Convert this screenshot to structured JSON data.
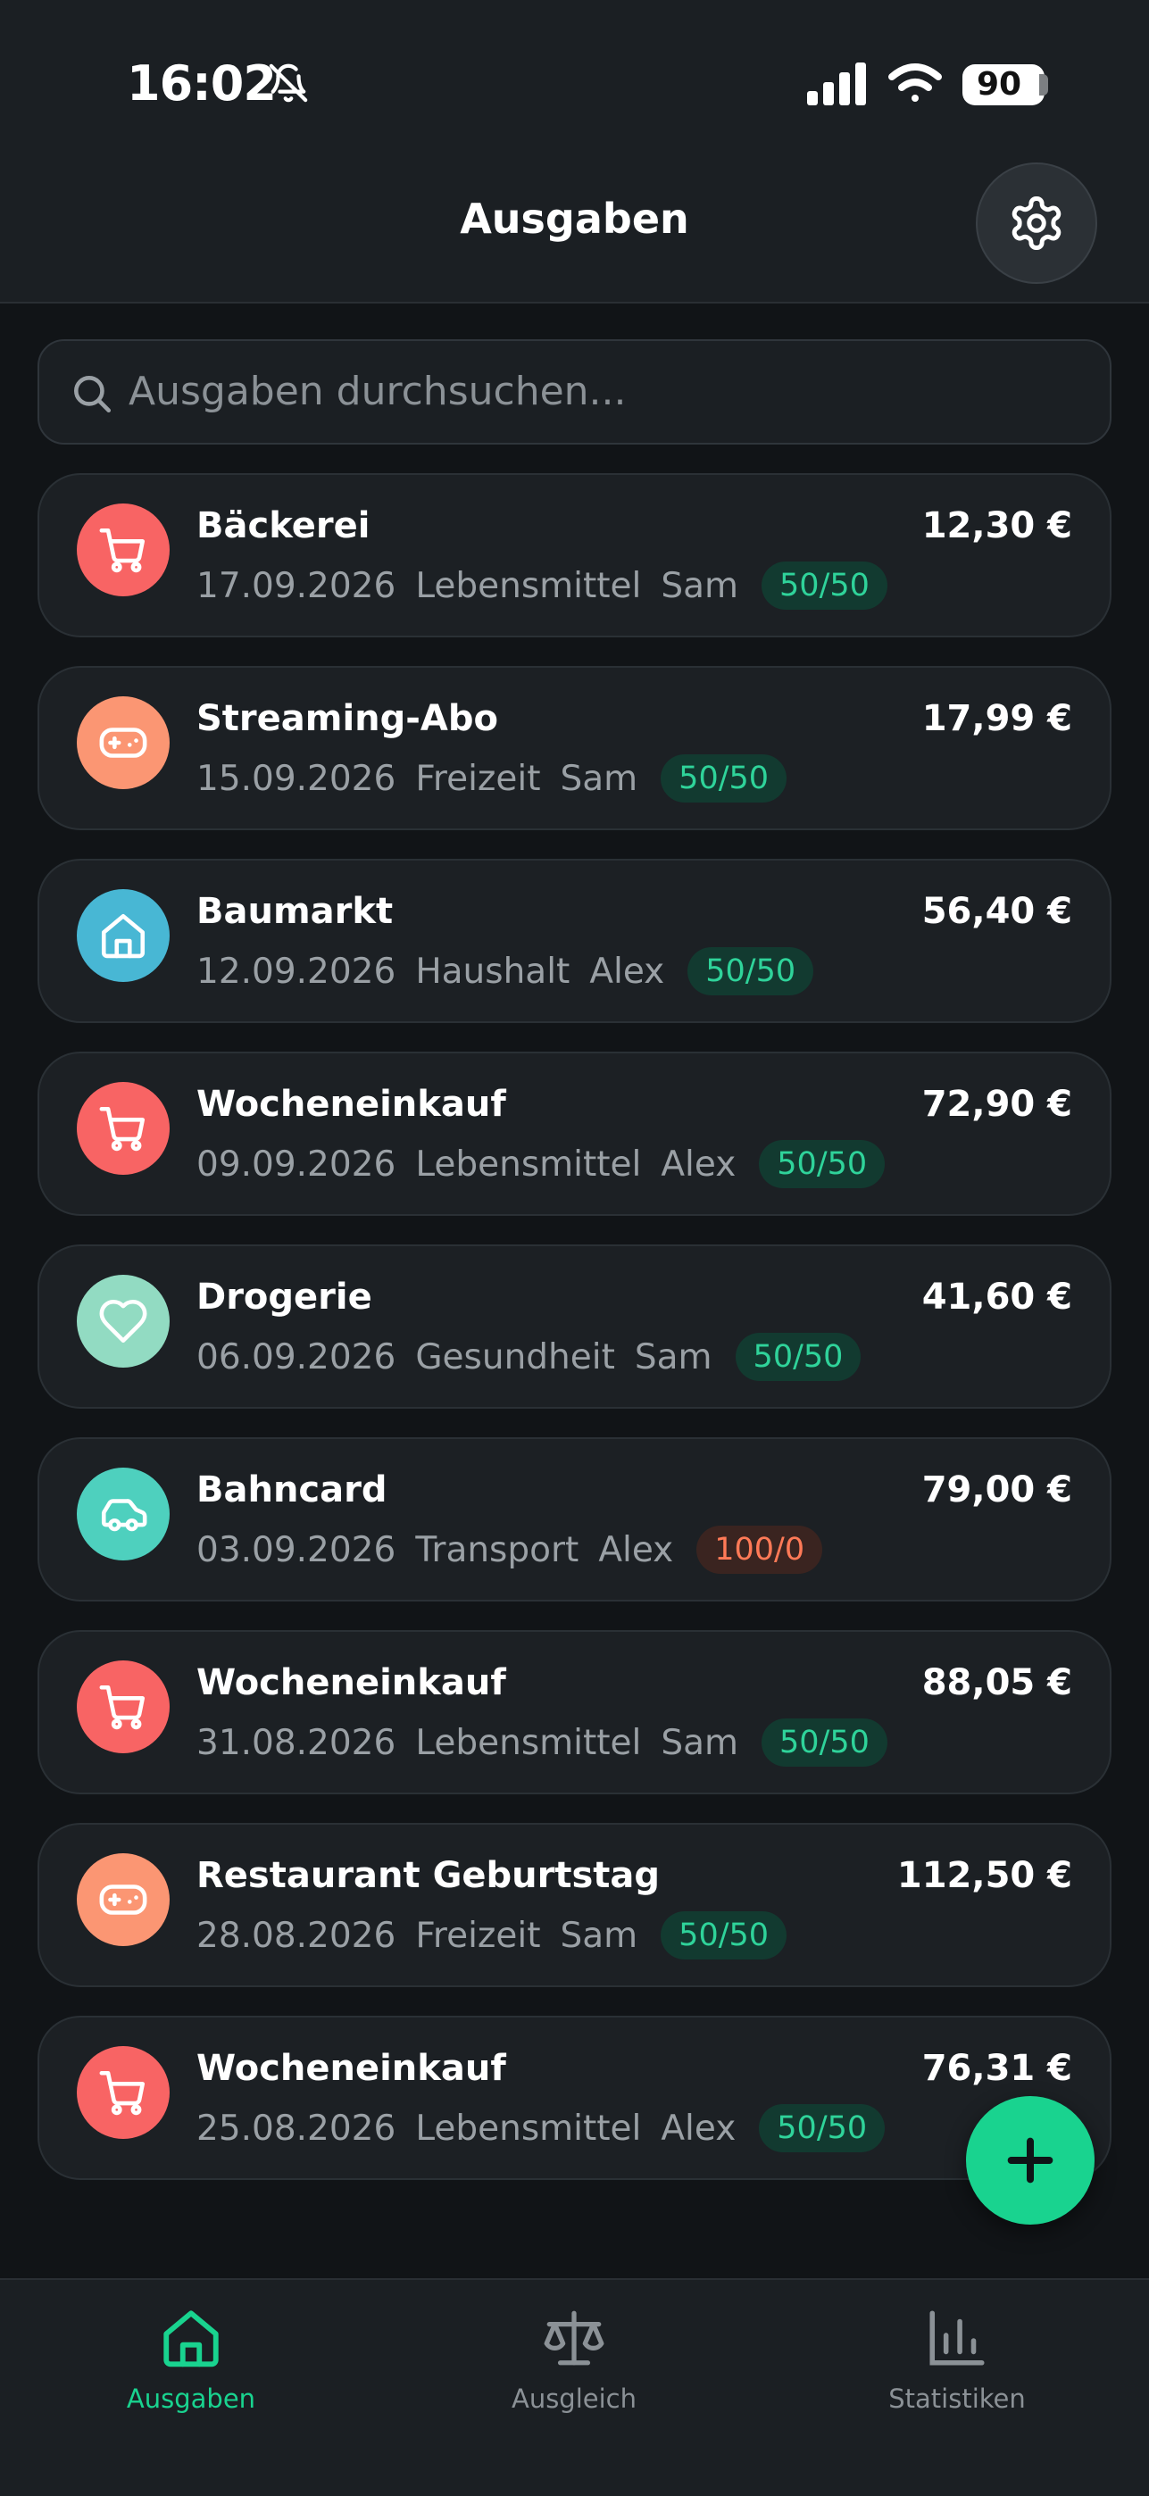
{
  "status_bar": {
    "time": "16:02",
    "battery": "90"
  },
  "header": {
    "title": "Ausgaben"
  },
  "search": {
    "placeholder": "Ausgaben durchsuchen..."
  },
  "expenses": [
    {
      "title": "Bäckerei",
      "date": "17.09.2026",
      "category": "Lebensmittel",
      "payer": "Sam",
      "split": "50/50",
      "amount": "12,30 €",
      "icon": "cart-icon",
      "color": "#f86464"
    },
    {
      "title": "Streaming-Abo",
      "date": "15.09.2026",
      "category": "Freizeit",
      "payer": "Sam",
      "split": "50/50",
      "amount": "17,99 €",
      "icon": "gamepad-icon",
      "color": "#fb9673"
    },
    {
      "title": "Baumarkt",
      "date": "12.09.2026",
      "category": "Haushalt",
      "payer": "Alex",
      "split": "50/50",
      "amount": "56,40 €",
      "icon": "home-icon",
      "color": "#48b7d4"
    },
    {
      "title": "Wocheneinkauf",
      "date": "09.09.2026",
      "category": "Lebensmittel",
      "payer": "Alex",
      "split": "50/50",
      "amount": "72,90 €",
      "icon": "cart-icon",
      "color": "#f86464"
    },
    {
      "title": "Drogerie",
      "date": "06.09.2026",
      "category": "Gesundheit",
      "payer": "Sam",
      "split": "50/50",
      "amount": "41,60 €",
      "icon": "heart-icon",
      "color": "#92dbc2"
    },
    {
      "title": "Bahncard",
      "date": "03.09.2026",
      "category": "Transport",
      "payer": "Alex",
      "split": "100/0",
      "amount": "79,00 €",
      "icon": "car-icon",
      "color": "#4ed0be"
    },
    {
      "title": "Wocheneinkauf",
      "date": "31.08.2026",
      "category": "Lebensmittel",
      "payer": "Sam",
      "split": "50/50",
      "amount": "88,05 €",
      "icon": "cart-icon",
      "color": "#f86464"
    },
    {
      "title": "Restaurant Geburtstag",
      "date": "28.08.2026",
      "category": "Freizeit",
      "payer": "Sam",
      "split": "50/50",
      "amount": "112,50 €",
      "icon": "gamepad-icon",
      "color": "#fb9673"
    },
    {
      "title": "Wocheneinkauf",
      "date": "25.08.2026",
      "category": "Lebensmittel",
      "payer": "Alex",
      "split": "50/50",
      "amount": "76,31 €",
      "icon": "cart-icon",
      "color": "#f86464"
    }
  ],
  "nav": {
    "items": [
      {
        "label": "Ausgaben",
        "icon": "home-icon",
        "active": true
      },
      {
        "label": "Ausgleich",
        "icon": "scale-icon",
        "active": false
      },
      {
        "label": "Statistiken",
        "icon": "bar-chart-icon",
        "active": false
      }
    ]
  },
  "colors": {
    "accent": "#19d38f",
    "split_green_text": "#2fd39a",
    "split_red_text": "#ff7a57"
  }
}
